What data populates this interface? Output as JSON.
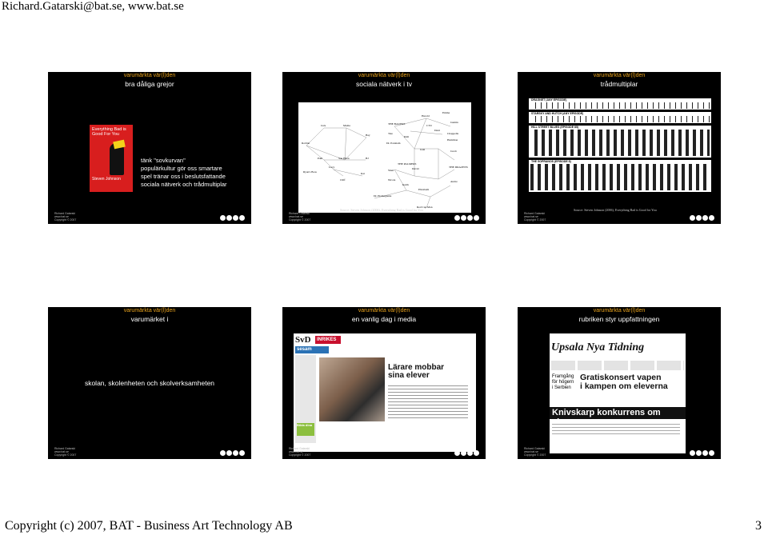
{
  "header": {
    "text": "Richard.Gatarski@bat.se, www.bat.se"
  },
  "footer": {
    "copyright": "Copyright (c) 2007, BAT - Business Art Technology AB",
    "page_number": "3"
  },
  "slide_common": {
    "top_label": "varumärkta vär(l)den",
    "footer_lines": [
      "Richard Gatarski",
      "www.bat.se",
      "Copyright © 2007"
    ]
  },
  "slides": [
    {
      "title": "bra dåliga grejor",
      "book": {
        "title": "Everything Bad is Good For You",
        "author": "Steven Johnson"
      },
      "bullets": [
        "tänk \"sovkurvan\"",
        "populärkultur gör oss smartare",
        "spel tränar oss i beslutsfattande",
        "sociala nätverk och trådmultiplar"
      ]
    },
    {
      "title": "sociala nätverk i tv",
      "network_labels": [
        "Jack",
        "Mama",
        "Robbie",
        "Bay",
        "Pam",
        "Sau Ellen",
        "BJ",
        "Lucy",
        "Ryan's Boss",
        "Kat",
        "Cliff",
        "THE BAUERS",
        "Tate",
        "Kim",
        "Harold",
        "Emma",
        "Jasmin",
        "Dr. Paraham",
        "Dani",
        "CTU",
        "Chappelle",
        "Hamilton",
        "Josh",
        "Jacob",
        "THE PALMERS",
        "THE DRAZENS",
        "Nicole",
        "Sheri",
        "David",
        "Elizabeth",
        "Andre",
        "Keith",
        "Dr. Eismaguane",
        "Red Cap Man"
      ],
      "source": "Source: Steven Johnson (2006), Everything Bad is Good for You"
    },
    {
      "title": "trådmultiplar",
      "shows": [
        "DRAGNET (ANY EPISODE)",
        "STARSKY AND HUTCH (ANY EPISODE)",
        "HILL STREET BLUES (EPISODE 85)",
        "THE SOPRANOS (EPISODE 8)"
      ],
      "source": "Source: Steven Johnson (2006), Everything Bad is Good for You"
    },
    {
      "title": "varumärket i",
      "bullets": [
        "skolan, skolenheten och skolverksamheten"
      ]
    },
    {
      "title": "en vanlig dag i media",
      "svd": {
        "logo": "SvD",
        "section": "INRIKES",
        "search": "sesam",
        "headline": [
          "Lärare mobbar",
          "sina elever"
        ],
        "tag": "Bilda dina"
      }
    },
    {
      "title": "rubriken styr uppfattningen",
      "unt": {
        "masthead": "Upsala Nya Tidning",
        "side": [
          "Framgång",
          "för högern",
          "i Serbien"
        ],
        "headline": [
          "Gratiskonsert vapen",
          "i kampen om eleverna"
        ],
        "band": "Knivskarp konkurrens om eleverna"
      }
    }
  ]
}
